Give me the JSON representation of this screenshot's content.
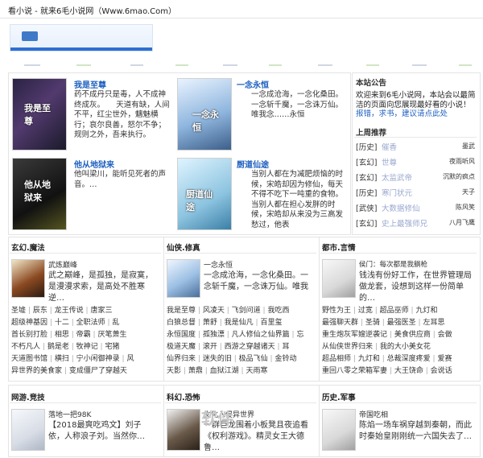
{
  "top": {
    "title": "看小说 - 就来6毛小说网（Www.6mao.Com）"
  },
  "featured": [
    {
      "title": "我是至尊",
      "desc": "药不成丹只是毒，人不成神终成灰。　　天道有缺，人间不平，红尘世外，魑魅横行；哀尔良善，怒尔不争；规则之外，吾来执行。",
      "cover_text": "我是至尊"
    },
    {
      "title": "一念永恒",
      "desc": "一念成沧海，一念化桑田。一念斩千魔，一念诛万仙。唯我念……永恒",
      "cover_text": "一念永恒"
    },
    {
      "title": "他从地狱来",
      "desc": "他叫梁川，能听见死者的声音。…",
      "cover_text": "他从地狱来"
    },
    {
      "title": "厨道仙途",
      "desc": "当别人都在为减肥烦恼的时候，宋皓却因为修仙，每天不得不吃下一吨重的食物。当别人都在担心发胖的时候，宋皓却从来没为三高发愁过，他表",
      "cover_text": "厨道仙途"
    }
  ],
  "notice": {
    "header": "本站公告",
    "body": "欢迎来到6毛小说网，本站会以最简洁的页面向您展现最好看的小说！",
    "links": "报错，求书，建议请点此处"
  },
  "updates": {
    "header": "上周推荐",
    "items": [
      {
        "cat": "[历史]",
        "name": "催香",
        "author": "墨武"
      },
      {
        "cat": "[玄幻]",
        "name": "世尊",
        "author": "夜雨听风"
      },
      {
        "cat": "[玄幻]",
        "name": "太监武帝",
        "author": "沉默的疯点"
      },
      {
        "cat": "[历史]",
        "name": "寒门状元",
        "author": "天子"
      },
      {
        "cat": "[武侠]",
        "name": "大数据修仙",
        "author": "陈风笑"
      },
      {
        "cat": "[玄幻]",
        "name": "史上最强师兄",
        "author": "八月飞鹰"
      }
    ]
  },
  "sections": [
    {
      "header": "玄幻.魔法",
      "book_title": "武炼巅峰",
      "book_desc": "武之巅峰，是孤独，是寂寞，是漫漫求索，是高处不胜寒逆…",
      "links": [
        [
          "圣墟",
          "辰东",
          "龙王传说",
          "唐家三"
        ],
        [
          "超级神基因",
          "十二",
          "全职法师",
          "乱"
        ],
        [
          "首长别打脸",
          "相思",
          "帝霸",
          "厌笔萧生"
        ],
        [
          "不朽凡人",
          "鹅是老",
          "牧神记",
          "宅猪"
        ],
        [
          "天道图书馆",
          "横扫",
          "宁小闲御神录",
          "风"
        ],
        [
          "异世界的美食家",
          "",
          "变成僵尸了穿越天",
          ""
        ]
      ]
    },
    {
      "header": "仙侠.修真",
      "book_title": "一念永恒",
      "book_desc": "一念成沧海，一念化桑田。一念斩千魔，一念诛万仙。唯我",
      "links": [
        [
          "我是至尊",
          "风凌天",
          "飞剑问道",
          "我吃西"
        ],
        [
          "白狼总督",
          "萧舒",
          "我是仙凡",
          "百里玺"
        ],
        [
          "永恒国度",
          "孤独漂",
          "凡人修仙之仙界篇",
          "忘"
        ],
        [
          "极道天魔",
          "滚开",
          "西游之穿越诸天",
          "耳"
        ],
        [
          "仙界归来",
          "迷失的旧",
          "极品飞仙",
          "金铃动"
        ],
        [
          "天影",
          "萧鼎",
          "血狱江湖",
          "天雨寒"
        ]
      ]
    },
    {
      "header": "都市.言情",
      "book_title": "侯门：每次都是我躺枪",
      "book_desc": "钱浅有份好工作，在世界管理局做龙套，设想到这样一份简单的…",
      "links": [
        [
          "野性为王",
          "过宽",
          "超品巫师",
          "九灯和"
        ],
        [
          "最强聊天群",
          "圣骑",
          "最强医圣",
          "左耳思"
        ],
        [
          "重生炮灰军嫂逆袭记",
          "美食供应商",
          "会做"
        ],
        [
          "从仙侠世界归来",
          "",
          "我的大小美女花",
          ""
        ],
        [
          "超品相师",
          "九灯和",
          "总裁深度疼爱",
          "爱赛"
        ],
        [
          "重回八零之荣箱军妻",
          "",
          "大王饶命",
          "会说话"
        ]
      ]
    },
    {
      "header": "网游.竞技",
      "book_title": "落地一把98K",
      "book_desc": "【2018最爽吃鸡文】刘子依，人称浪子刘。当然你…"
    },
    {
      "header": "科幻.恐怖",
      "book_title": "文化入侵异世界",
      "book_desc": "一群巨龙围着小板凳且夜追看《权利游戏》。精灵女王大德鲁…"
    },
    {
      "header": "历史.军事",
      "book_title": "帝国吃相",
      "book_desc": "陈焰一场车祸穿越到秦朝，而此时秦始皇刚刚统一六国失去了…"
    }
  ],
  "watermark": "软件"
}
